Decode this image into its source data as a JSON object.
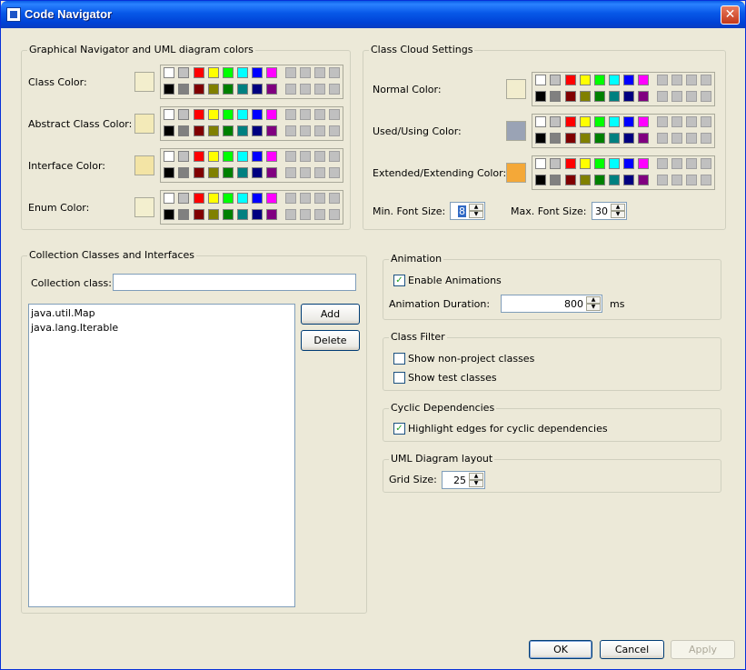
{
  "window": {
    "title": "Code Navigator",
    "close": "✕"
  },
  "palette": {
    "row1": [
      "#ffffff",
      "#c0c0c0",
      "#ff0000",
      "#ffff00",
      "#00ff00",
      "#00ffff",
      "#0000ff",
      "#ff00ff"
    ],
    "row2": [
      "#000000",
      "#808080",
      "#800000",
      "#808000",
      "#008000",
      "#008080",
      "#000080",
      "#800080"
    ]
  },
  "graphical": {
    "title": "Graphical Navigator and UML diagram colors",
    "items": [
      {
        "label": "Class Color:",
        "color": "#f3eecd"
      },
      {
        "label": "Abstract Class Color:",
        "color": "#f3eab8"
      },
      {
        "label": "Interface Color:",
        "color": "#f3e4a5"
      },
      {
        "label": "Enum Color:",
        "color": "#f3efcf"
      }
    ]
  },
  "cloud": {
    "title": "Class Cloud Settings",
    "items": [
      {
        "label": "Normal Color:",
        "color": "#f2edce"
      },
      {
        "label": "Used/Using Color:",
        "color": "#9aa3b5"
      },
      {
        "label": "Extended/Extending Color:",
        "color": "#f4a838"
      }
    ],
    "min_font_label": "Min. Font Size:",
    "min_font_value": "8",
    "max_font_label": "Max. Font Size:",
    "max_font_value": "30"
  },
  "collections": {
    "title": "Collection Classes and Interfaces",
    "class_label": "Collection class:",
    "class_value": "",
    "items": [
      "java.util.Map",
      "java.lang.Iterable"
    ],
    "add_label": "Add",
    "delete_label": "Delete"
  },
  "animation": {
    "title": "Animation",
    "enable_label": "Enable Animations",
    "enable_checked": true,
    "duration_label": "Animation Duration:",
    "duration_value": "800",
    "unit": "ms"
  },
  "class_filter": {
    "title": "Class Filter",
    "non_project_label": "Show non-project classes",
    "non_project_checked": false,
    "test_label": "Show test classes",
    "test_checked": false
  },
  "cyclic": {
    "title": "Cyclic Dependencies",
    "highlight_label": "Highlight edges for cyclic dependencies",
    "highlight_checked": true
  },
  "uml_layout": {
    "title": "UML Diagram layout",
    "grid_label": "Grid Size:",
    "grid_value": "25"
  },
  "footer": {
    "ok": "OK",
    "cancel": "Cancel",
    "apply": "Apply"
  }
}
